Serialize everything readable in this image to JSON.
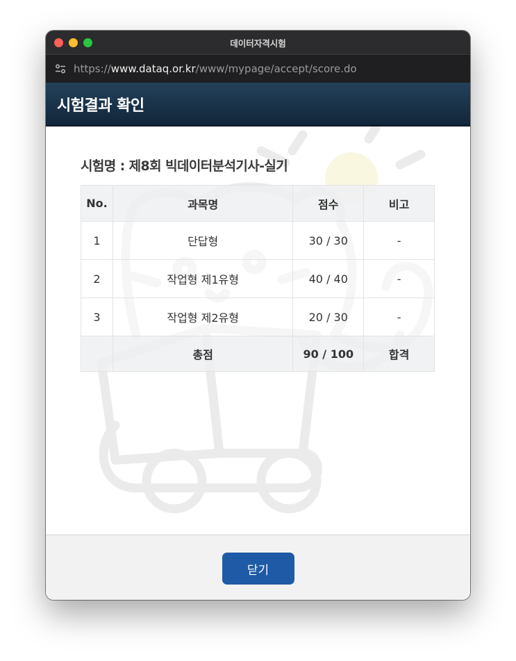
{
  "window": {
    "title": "데이터자격시험"
  },
  "urlbar": {
    "scheme": "https://",
    "host": "www.dataq.or.kr",
    "path": "/www/mypage/accept/score.do"
  },
  "header": {
    "title": "시험결과 확인"
  },
  "exam": {
    "title": "시험명 : 제8회 빅데이터분석기사-실기"
  },
  "table": {
    "headers": [
      "No.",
      "과목명",
      "점수",
      "비고"
    ],
    "rows": [
      {
        "no": "1",
        "subject": "단답형",
        "score": "30 / 30",
        "note": "-"
      },
      {
        "no": "2",
        "subject": "작업형 제1유형",
        "score": "40 / 40",
        "note": "-"
      },
      {
        "no": "3",
        "subject": "작업형 제2유형",
        "score": "20 / 30",
        "note": "-"
      }
    ],
    "total": {
      "label": "총점",
      "score": "90 / 100",
      "result": "합격"
    }
  },
  "footer": {
    "close_label": "닫기"
  },
  "colors": {
    "header_bg": "#1b3349",
    "button": "#1f5aa6"
  }
}
